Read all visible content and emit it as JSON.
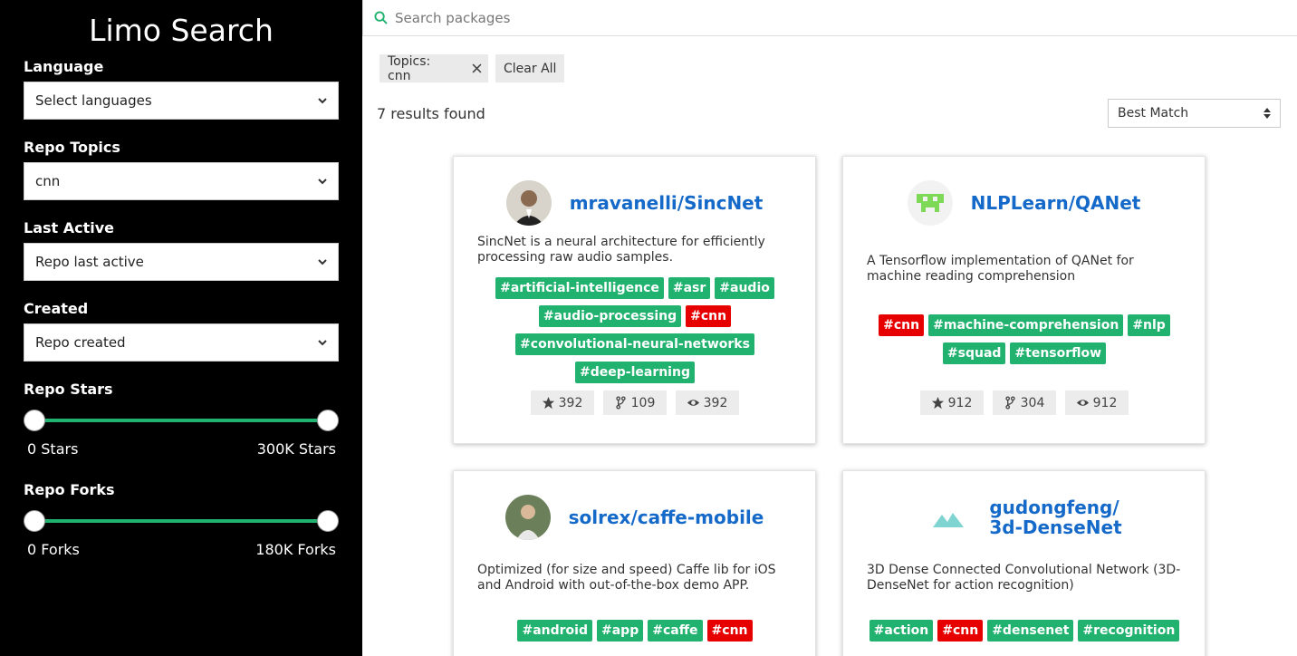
{
  "sidebar": {
    "title": "Limo Search",
    "language": {
      "label": "Language",
      "value": "Select languages"
    },
    "topics": {
      "label": "Repo Topics",
      "value": "cnn"
    },
    "last_active": {
      "label": "Last Active",
      "value": "Repo last active"
    },
    "created": {
      "label": "Created",
      "value": "Repo created"
    },
    "stars": {
      "label": "Repo Stars",
      "min": "0 Stars",
      "max": "300K Stars"
    },
    "forks": {
      "label": "Repo Forks",
      "min": "0 Forks",
      "max": "180K Forks"
    }
  },
  "search": {
    "placeholder": "Search packages"
  },
  "filters": {
    "chip_label": "Topics: cnn",
    "clear_all": "Clear All"
  },
  "results": {
    "count_text": "7 results found",
    "sort_value": "Best Match"
  },
  "colors": {
    "accent": "#21b26f",
    "link": "#1469c9",
    "highlight_tag": "#e60000"
  },
  "cards": [
    {
      "name": "mravanelli/SincNet",
      "description": "SincNet is a neural architecture for efficiently processing raw audio samples.",
      "tags": [
        "#artificial-intelligence",
        "#asr",
        "#audio",
        "#audio-processing",
        "#cnn",
        "#convolutional-neural-networks",
        "#deep-learning"
      ],
      "stars": "392",
      "forks": "109",
      "watchers": "392"
    },
    {
      "name": "NLPLearn/QANet",
      "description": "A Tensorflow implementation of QANet for machine reading comprehension",
      "tags": [
        "#cnn",
        "#machine-comprehension",
        "#nlp",
        "#squad",
        "#tensorflow"
      ],
      "stars": "912",
      "forks": "304",
      "watchers": "912"
    },
    {
      "name": "solrex/caffe-mobile",
      "description": "Optimized (for size and speed) Caffe lib for iOS and Android with out-of-the-box demo APP.",
      "tags": [
        "#android",
        "#app",
        "#caffe",
        "#cnn"
      ]
    },
    {
      "name_line1": "gudongfeng/",
      "name_line2": "3d-DenseNet",
      "description": "3D Dense Connected Convolutional Network (3D-DenseNet for action recognition)",
      "tags": [
        "#action",
        "#cnn",
        "#densenet",
        "#recognition"
      ]
    }
  ]
}
